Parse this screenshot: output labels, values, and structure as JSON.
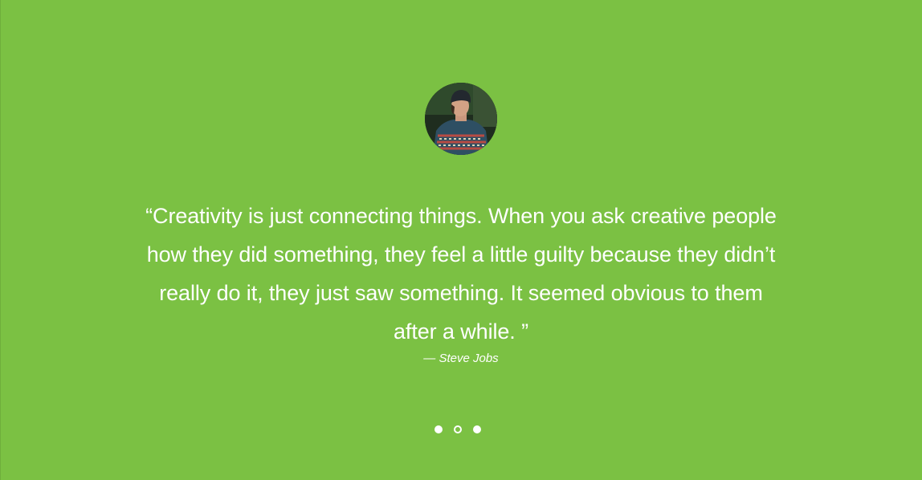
{
  "testimonial": {
    "avatar_alt": "avatar",
    "quote": "“Creativity is just connecting things. When you ask creative people how they did something, they feel a little guilty because they didn’t really do it, they just saw something. It seemed obvious to them after a while. ”",
    "author": "— Steve Jobs"
  },
  "pager": {
    "count": 3,
    "active_index": 1
  },
  "colors": {
    "background": "#7bc143",
    "text": "#ffffff"
  }
}
